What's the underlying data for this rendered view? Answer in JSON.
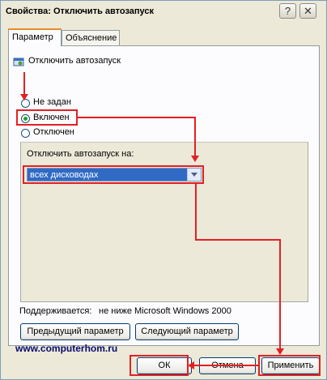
{
  "window": {
    "title": "Свойства: Отключить автозапуск",
    "help_label": "?",
    "close_label": "✕"
  },
  "tabs": [
    {
      "label": "Параметр",
      "active": true
    },
    {
      "label": "Объяснение",
      "active": false
    }
  ],
  "policy": {
    "icon": "policy-setting-icon",
    "name": "Отключить автозапуск"
  },
  "options": {
    "not_configured": "Не задан",
    "enabled": "Включен",
    "disabled": "Отключен",
    "selected": "enabled"
  },
  "setting": {
    "label": "Отключить автозапуск на:",
    "dropdown_value": "всех дисководах"
  },
  "supported": {
    "label": "Поддерживается:",
    "value": "не ниже Microsoft Windows 2000"
  },
  "nav": {
    "prev_label": "Предыдущий параметр",
    "next_label": "Следующий параметр"
  },
  "watermark": "www.computerhom.ru",
  "buttons": {
    "ok_label": "ОК",
    "cancel_label": "Отмена",
    "apply_label": "Применить"
  },
  "colors": {
    "annotation_red": "#e32025",
    "selection_blue": "#316ac5"
  }
}
